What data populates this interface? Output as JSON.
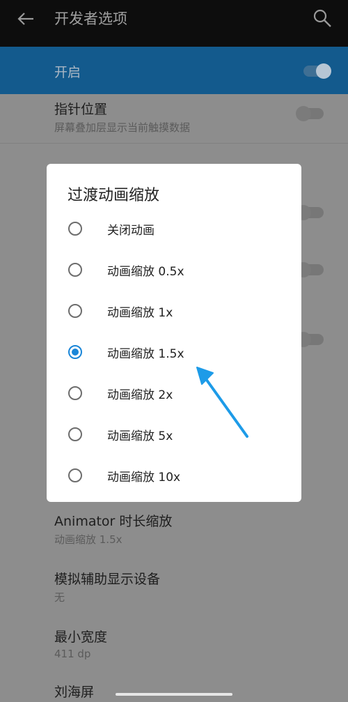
{
  "app_bar": {
    "title": "开发者选项",
    "back_icon": "back-arrow-icon",
    "search_icon": "search-icon"
  },
  "master_toggle": {
    "label": "开启",
    "on": true
  },
  "background_settings": [
    {
      "title": "指针位置",
      "subtitle": "屏幕叠加层显示当前触摸数据",
      "switch": false
    },
    {
      "title": "Animator 时长缩放",
      "subtitle": "动画缩放 1.5x"
    },
    {
      "title": "模拟辅助显示设备",
      "subtitle": "无"
    },
    {
      "title": "最小宽度",
      "subtitle": "411 dp"
    },
    {
      "title": "刘海屏"
    }
  ],
  "dialog": {
    "title": "过渡动画缩放",
    "selected_index": 3,
    "options": [
      "关闭动画",
      "动画缩放 0.5x",
      "动画缩放 1x",
      "动画缩放 1.5x",
      "动画缩放 2x",
      "动画缩放 5x",
      "动画缩放 10x"
    ]
  },
  "colors": {
    "accent": "#1a86d8",
    "annotation_arrow": "#1d9be8"
  }
}
